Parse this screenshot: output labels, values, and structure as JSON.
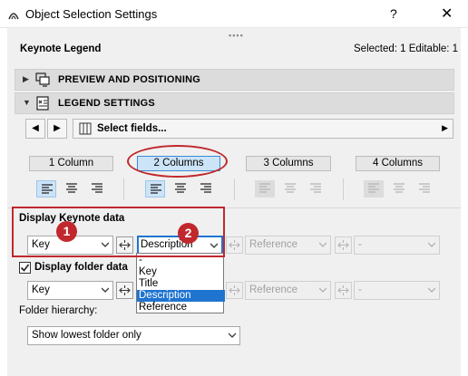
{
  "window": {
    "title": "Object Selection Settings",
    "help": "?",
    "close": "✕"
  },
  "header": {
    "object_label": "Keynote Legend",
    "selection_status": "Selected: 1 Editable: 1"
  },
  "sections": {
    "preview": "PREVIEW AND POSITIONING",
    "legend": "LEGEND SETTINGS"
  },
  "toolbar": {
    "select_fields": "Select fields..."
  },
  "columns": {
    "options": [
      "1 Column",
      "2 Columns",
      "3 Columns",
      "4 Columns"
    ],
    "selected": "2 Columns"
  },
  "keynote_data": {
    "heading": "Display Keynote data",
    "field1": "Key",
    "field2": "Description",
    "field3": "Reference",
    "field4": "-"
  },
  "folder_data": {
    "checkbox_label": "Display folder data",
    "checked": true,
    "field1": "Key",
    "field3": "Reference",
    "field4": "-"
  },
  "dropdown": {
    "options": [
      "-",
      "Key",
      "Title",
      "Description",
      "Reference"
    ],
    "selected": "Description"
  },
  "hierarchy": {
    "label": "Folder hierarchy:",
    "value": "Show lowest folder only"
  },
  "annotations": {
    "badge1": "1",
    "badge2": "2",
    "highlight_color": "#c0282d"
  },
  "colors": {
    "accent": "#1f74d0",
    "active_button": "#cce4f7"
  }
}
